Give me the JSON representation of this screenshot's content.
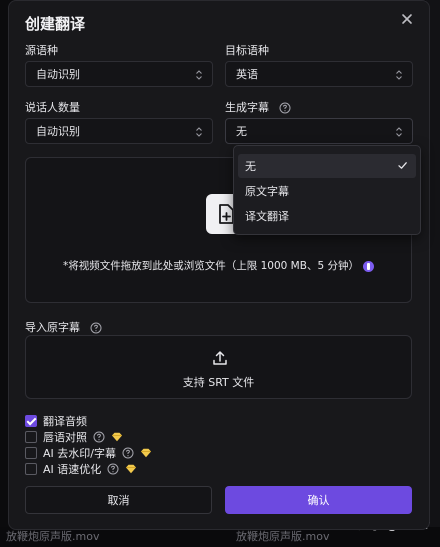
{
  "dialog": {
    "title": "创建翻译",
    "source_language": {
      "label": "源语种",
      "value": "自动识别"
    },
    "target_language": {
      "label": "目标语种",
      "value": "英语"
    },
    "speaker_count": {
      "label": "说话人数量",
      "value": "自动识别"
    },
    "generate_subtitles": {
      "label": "生成字幕",
      "value": "无",
      "options": [
        {
          "label": "无",
          "selected": true
        },
        {
          "label": "原文字幕",
          "selected": false
        },
        {
          "label": "译文翻译",
          "selected": false
        }
      ]
    },
    "upload": {
      "text": "*将视频文件拖放到此处或浏览文件（上限 1000 MB、5 分钟）"
    },
    "import_subtitle": {
      "label": "导入原字幕",
      "button_text": "支持 SRT 文件"
    },
    "options": [
      {
        "label": "翻译音频",
        "checked": true,
        "help": false,
        "premium": false
      },
      {
        "label": "唇语对照",
        "checked": false,
        "help": true,
        "premium": true
      },
      {
        "label": "AI 去水印/字幕",
        "checked": false,
        "help": true,
        "premium": true
      },
      {
        "label": "AI 语速优化",
        "checked": false,
        "help": true,
        "premium": true
      }
    ],
    "cancel_label": "取消",
    "confirm_label": "确认"
  },
  "background": {
    "file_left": "放鞭炮原声版.mov",
    "file_mid": "放鞭炮原声版.mov",
    "watermark": "知乎 @ViiTor"
  },
  "colors": {
    "accent": "#6d4ae0",
    "dialog_bg": "#18181b",
    "premium_gem": "#f2c94c"
  },
  "icons": {
    "close": "close-icon",
    "caret": "chevron-updown-icon",
    "help": "question-circle-icon",
    "upload": "file-plus-icon",
    "srt": "upload-icon",
    "check": "check-icon",
    "premium": "diamond-icon",
    "info": "info-icon"
  }
}
